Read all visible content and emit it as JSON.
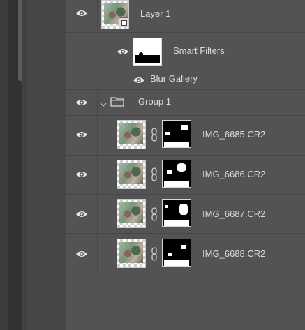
{
  "layers_panel": {
    "layers": [
      {
        "name": "Layer 1",
        "visible": true,
        "type": "smart-object"
      },
      {
        "name": "Smart Filters",
        "visible": true,
        "type": "smart-filters"
      },
      {
        "name": "Blur Gallery",
        "visible": true,
        "type": "filter"
      },
      {
        "name": "Group 1",
        "visible": true,
        "type": "group",
        "collapsed": false
      },
      {
        "name": "IMG_6685.CR2",
        "visible": true,
        "type": "masked-layer"
      },
      {
        "name": "IMG_6686.CR2",
        "visible": true,
        "type": "masked-layer"
      },
      {
        "name": "IMG_6687.CR2",
        "visible": true,
        "type": "masked-layer"
      },
      {
        "name": "IMG_6688.CR2",
        "visible": true,
        "type": "masked-layer"
      }
    ]
  },
  "colors": {
    "panel_bg": "#535353",
    "row_divider": "#474747",
    "text": "#dcdcdc"
  },
  "icons": {
    "visibility": "eye-icon",
    "group": "folder-icon",
    "expand": "chevron-down-icon",
    "mask_link": "chain-link-icon"
  }
}
